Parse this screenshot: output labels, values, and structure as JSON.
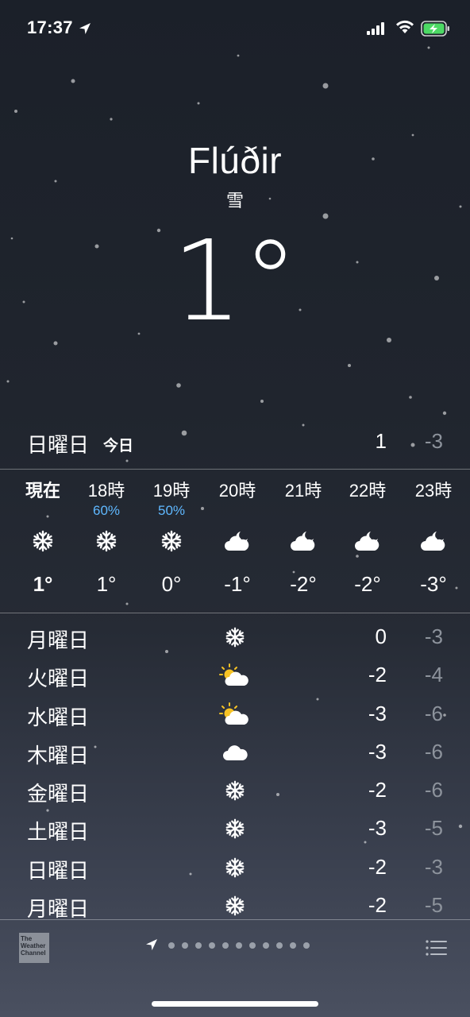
{
  "status_bar": {
    "time": "17:37"
  },
  "location": {
    "city": "Flúðir",
    "condition": "雪",
    "current_temp": "1°"
  },
  "today": {
    "day": "日曜日",
    "label": "今日",
    "high": "1",
    "low": "-3"
  },
  "hourly": [
    {
      "label": "現在",
      "pop": "",
      "icon": "snowflake-icon",
      "temp": "1°"
    },
    {
      "label": "18時",
      "pop": "60%",
      "icon": "snowflake-icon",
      "temp": "1°"
    },
    {
      "label": "19時",
      "pop": "50%",
      "icon": "snowflake-icon",
      "temp": "0°"
    },
    {
      "label": "20時",
      "pop": "",
      "icon": "cloudy-night-icon",
      "temp": "-1°"
    },
    {
      "label": "21時",
      "pop": "",
      "icon": "cloudy-night-icon",
      "temp": "-2°"
    },
    {
      "label": "22時",
      "pop": "",
      "icon": "cloudy-night-icon",
      "temp": "-2°"
    },
    {
      "label": "23時",
      "pop": "",
      "icon": "cloudy-night-icon",
      "temp": "-3°"
    }
  ],
  "daily": [
    {
      "day": "月曜日",
      "icon": "snowflake-icon",
      "high": "0",
      "low": "-3"
    },
    {
      "day": "火曜日",
      "icon": "partly-sunny-icon",
      "high": "-2",
      "low": "-4"
    },
    {
      "day": "水曜日",
      "icon": "partly-sunny-icon",
      "high": "-3",
      "low": "-6"
    },
    {
      "day": "木曜日",
      "icon": "cloud-icon",
      "high": "-3",
      "low": "-6"
    },
    {
      "day": "金曜日",
      "icon": "snowflake-icon",
      "high": "-2",
      "low": "-6"
    },
    {
      "day": "土曜日",
      "icon": "snowflake-icon",
      "high": "-3",
      "low": "-5"
    },
    {
      "day": "日曜日",
      "icon": "snowflake-icon",
      "high": "-2",
      "low": "-3"
    },
    {
      "day": "月曜日",
      "icon": "snowflake-icon",
      "high": "-2",
      "low": "-5"
    }
  ],
  "footer": {
    "logo_text": "The Weather Channel",
    "page_count": 11
  },
  "colors": {
    "precip": "#5fb8ff",
    "low_temp": "#8d939c",
    "battery": "#4cd964",
    "sun": "#f7c325"
  }
}
